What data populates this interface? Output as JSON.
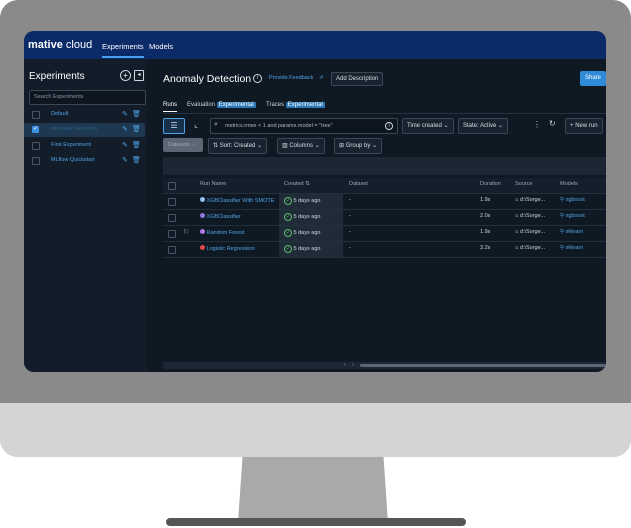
{
  "app": {
    "brand_prefix": "mative",
    "brand_suffix": "cloud",
    "nav": [
      "Experiments",
      "Models"
    ]
  },
  "sidebar": {
    "title": "Experiments",
    "search_placeholder": "Search Experiments",
    "items": [
      {
        "label": "Default",
        "checked": false
      },
      {
        "label": "Anomaly Detection",
        "checked": true
      },
      {
        "label": "First Experiment",
        "checked": false
      },
      {
        "label": "MLflow Quickstart",
        "checked": false
      }
    ]
  },
  "header": {
    "title": "Anomaly Detection",
    "feedback": "Provide Feedback",
    "add_description": "Add Description",
    "share": "Share"
  },
  "tabs": {
    "runs": "Runs",
    "evaluation": "Evaluation",
    "evaluation_tag": "Experimental",
    "traces": "Traces",
    "traces_tag": "Experimental"
  },
  "toolbar": {
    "search_value": "metrics.rmse < 1 and params.model = \"tree\"",
    "time_created": "Time created",
    "state": "State: Active",
    "new_run": "New run",
    "datasets": "Datasets",
    "sort": "Sort: Created",
    "columns": "Columns",
    "group_by": "Group by"
  },
  "table": {
    "headers": {
      "run_name": "Run Name",
      "created": "Created",
      "dataset": "Dataset",
      "duration": "Duration",
      "source": "Source",
      "models": "Models"
    },
    "rows": [
      {
        "name": "XGBClassifier With SMOTE",
        "color": "#8fc3ef",
        "created": "5 days ago",
        "dataset": "-",
        "duration": "1.9s",
        "source": "d:\\Sorge...",
        "model": "xgboost"
      },
      {
        "name": "XGBClassifier",
        "color": "#8f79d8",
        "created": "5 days ago",
        "dataset": "-",
        "duration": "2.0s",
        "source": "d:\\Sorge...",
        "model": "xgboost"
      },
      {
        "name": "Random Forest",
        "color": "#b07ae0",
        "created": "5 days ago",
        "dataset": "-",
        "duration": "1.9s",
        "source": "d:\\Sorge...",
        "model": "sklearn"
      },
      {
        "name": "Logistic Regression",
        "color": "#e0494b",
        "created": "5 days ago",
        "dataset": "-",
        "duration": "3.2s",
        "source": "d:\\Sorge...",
        "model": "sklearn"
      }
    ]
  },
  "colors": {
    "topbar": "#0b2a68",
    "accent": "#2b78b8",
    "background": "#0f1923"
  }
}
